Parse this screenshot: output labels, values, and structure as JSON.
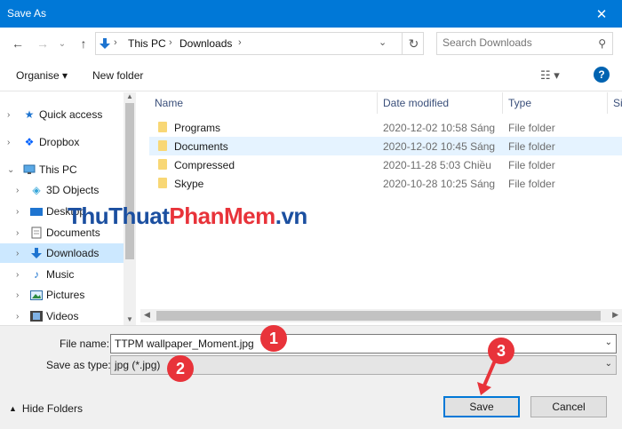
{
  "window": {
    "title": "Save As"
  },
  "nav": {
    "breadcrumb": [
      "This PC",
      "Downloads"
    ],
    "search_placeholder": "Search Downloads"
  },
  "toolbar": {
    "organise": "Organise ▾",
    "new_folder": "New folder",
    "help": "?"
  },
  "sidebar": {
    "items": [
      {
        "label": "Quick access",
        "icon": "star-icon"
      },
      {
        "label": "Dropbox",
        "icon": "dropbox-icon"
      },
      {
        "label": "This PC",
        "icon": "computer-icon"
      },
      {
        "label": "3D Objects",
        "icon": "cube-icon"
      },
      {
        "label": "Desktop",
        "icon": "desktop-icon"
      },
      {
        "label": "Documents",
        "icon": "document-icon"
      },
      {
        "label": "Downloads",
        "icon": "download-icon"
      },
      {
        "label": "Music",
        "icon": "music-icon"
      },
      {
        "label": "Pictures",
        "icon": "pictures-icon"
      },
      {
        "label": "Videos",
        "icon": "videos-icon"
      }
    ],
    "selected": "Downloads"
  },
  "files": {
    "columns": [
      "Name",
      "Date modified",
      "Type",
      "Si"
    ],
    "rows": [
      {
        "name": "Programs",
        "date": "2020-12-02 10:58 Sáng",
        "type": "File folder"
      },
      {
        "name": "Documents",
        "date": "2020-12-02 10:45 Sáng",
        "type": "File folder"
      },
      {
        "name": "Compressed",
        "date": "2020-11-28 5:03 Chiều",
        "type": "File folder"
      },
      {
        "name": "Skype",
        "date": "2020-10-28 10:25 Sáng",
        "type": "File folder"
      }
    ],
    "selected_row": "Documents"
  },
  "form": {
    "file_name_label": "File name:",
    "file_name_value": "TTPM wallpaper_Moment.jpg",
    "save_type_label": "Save as type:",
    "save_type_value": "jpg (*.jpg)"
  },
  "footer": {
    "hide_folders": "Hide Folders",
    "save": "Save",
    "cancel": "Cancel"
  },
  "annotations": [
    "1",
    "2",
    "3"
  ],
  "watermark": {
    "part1": "ThuThuat",
    "part2": "PhanMem",
    "part3": ".vn"
  },
  "colors": {
    "accent": "#0078d7",
    "badge": "#e8333a",
    "selection": "#cce8ff"
  }
}
